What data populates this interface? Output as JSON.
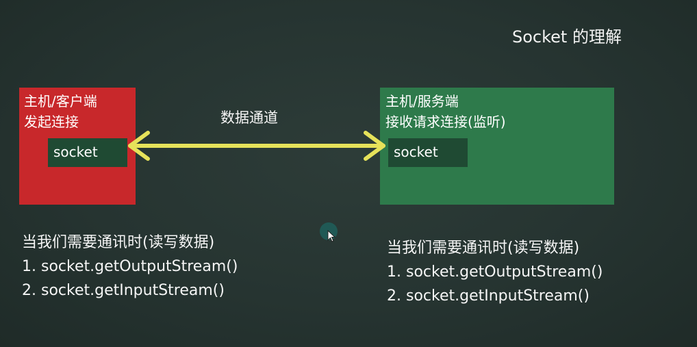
{
  "slide": {
    "title": "Socket 的理解"
  },
  "client": {
    "line1": "主机/客户端",
    "line2": "发起连接",
    "socket_label": "socket",
    "color": "#c8282b"
  },
  "server": {
    "line1": "主机/服务端",
    "line2": "接收请求连接(监听)",
    "socket_label": "socket",
    "color": "#2e7a4b"
  },
  "channel": {
    "label": "数据通道",
    "arrow_color": "#e6e25a"
  },
  "client_steps": {
    "heading": "当我们需要通讯时(读写数据)",
    "step1": "1. socket.getOutputStream()",
    "step2": "2. socket.getInputStream()"
  },
  "server_steps": {
    "heading": "当我们需要通讯时(读写数据)",
    "step1": "1. socket.getOutputStream()",
    "step2": "2. socket.getInputStream()"
  },
  "background_color": "#263431"
}
